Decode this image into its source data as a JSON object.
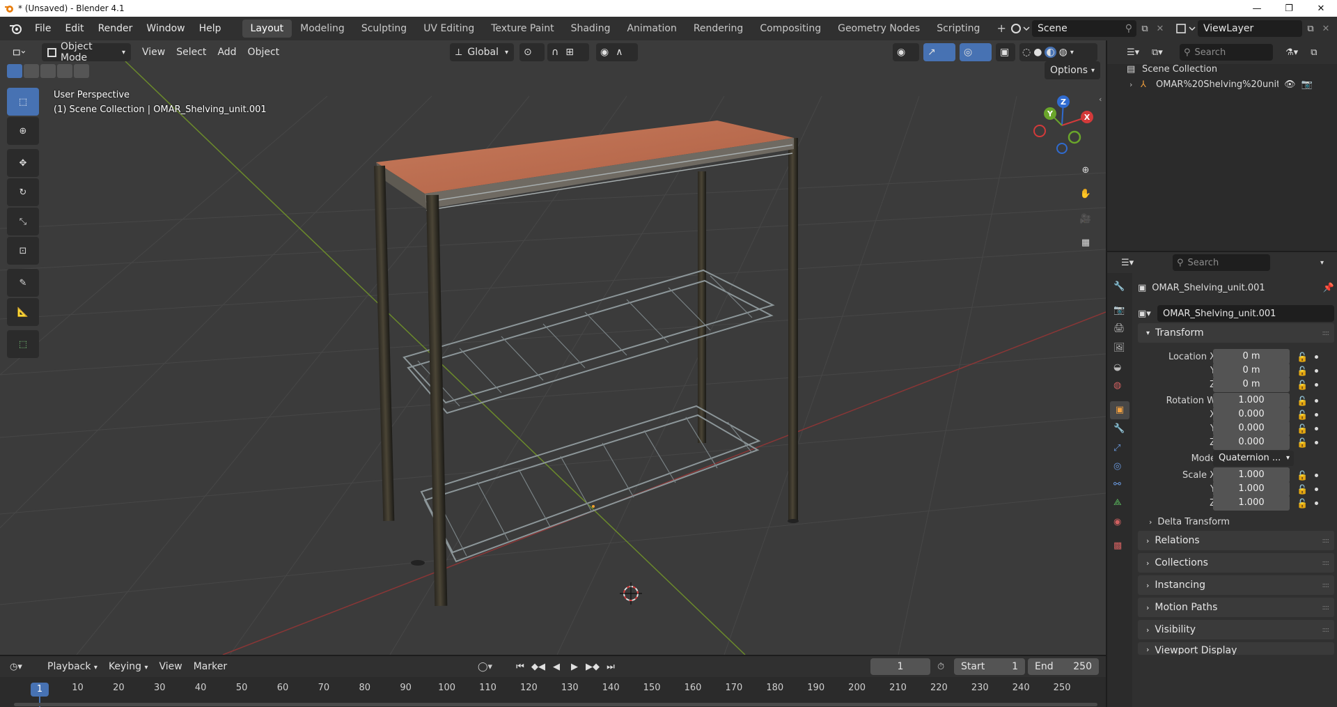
{
  "window": {
    "title": "* (Unsaved) - Blender 4.1",
    "minimize": "—",
    "maximize": "❐",
    "close": "✕"
  },
  "menu": [
    "File",
    "Edit",
    "Render",
    "Window",
    "Help"
  ],
  "workspaces": [
    "Layout",
    "Modeling",
    "Sculpting",
    "UV Editing",
    "Texture Paint",
    "Shading",
    "Animation",
    "Rendering",
    "Compositing",
    "Geometry Nodes",
    "Scripting"
  ],
  "active_workspace": "Layout",
  "scene": {
    "name": "Scene",
    "view_layer": "ViewLayer"
  },
  "viewport": {
    "mode": "Object Mode",
    "menus": [
      "View",
      "Select",
      "Add",
      "Object"
    ],
    "orientation": "Global",
    "options_label": "Options",
    "info_line1": "User Perspective",
    "info_line2": "(1) Scene Collection | OMAR_Shelving_unit.001",
    "gizmo_labels": {
      "x": "X",
      "y": "Y",
      "z": "Z"
    }
  },
  "outliner": {
    "search_placeholder": "Search",
    "root": "Scene Collection",
    "items": [
      {
        "label": "OMAR%20Shelving%20unit"
      }
    ]
  },
  "properties": {
    "search_placeholder": "Search",
    "object_name": "OMAR_Shelving_unit.001",
    "object_field": "OMAR_Shelving_unit.001",
    "transform": {
      "title": "Transform",
      "location_label": "Location X",
      "location": [
        "0 m",
        "0 m",
        "0 m"
      ],
      "rotation_label": "Rotation W",
      "rotation": [
        "1.000",
        "0.000",
        "0.000",
        "0.000"
      ],
      "mode_label": "Mode",
      "mode_value": "Quaternion ...",
      "scale_label": "Scale X",
      "scale": [
        "1.000",
        "1.000",
        "1.000"
      ],
      "axis_y": "Y",
      "axis_z": "Z",
      "axis_x": "X",
      "delta": "Delta Transform"
    },
    "sections": [
      "Relations",
      "Collections",
      "Instancing",
      "Motion Paths",
      "Visibility"
    ],
    "cut_section": "Viewport Display"
  },
  "timeline": {
    "menus": [
      "Playback",
      "Keying",
      "View",
      "Marker"
    ],
    "current_frame": "1",
    "start_label": "Start",
    "start": "1",
    "end_label": "End",
    "end": "250",
    "ruler": [
      "10",
      "20",
      "30",
      "40",
      "50",
      "60",
      "70",
      "80",
      "90",
      "100",
      "110",
      "120",
      "130",
      "140",
      "150",
      "160",
      "170",
      "180",
      "190",
      "200",
      "210",
      "220",
      "230",
      "240",
      "250"
    ],
    "playhead": "1"
  }
}
